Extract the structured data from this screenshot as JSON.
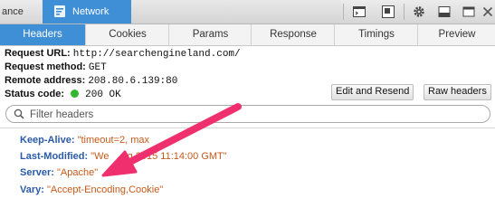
{
  "toolbar": {
    "prev_tab_label": "ance",
    "active_tab_label": "Network"
  },
  "subtabs": [
    "Headers",
    "Cookies",
    "Params",
    "Response",
    "Timings",
    "Preview"
  ],
  "request": {
    "url_label": "Request URL:",
    "url_value": "http://searchengineland.com/",
    "method_label": "Request method:",
    "method_value": "GET",
    "remote_label": "Remote address:",
    "remote_value": "208.80.6.139:80",
    "status_label": "Status code:",
    "status_value": "200 OK",
    "status_color": "#31b82f"
  },
  "buttons": {
    "edit_resend": "Edit and Resend",
    "raw_headers": "Raw headers"
  },
  "filter": {
    "placeholder": "Filter headers"
  },
  "headers": [
    {
      "key": "Keep-Alive:",
      "value": "\"timeout=2, max"
    },
    {
      "key": "Last-Modified:",
      "value": "\"We",
      "value_tail": "ug 2015 11:14:00 GMT\""
    },
    {
      "key": "Server:",
      "value": "\"Apache\""
    },
    {
      "key": "Vary:",
      "value": "\"Accept-Encoding,Cookie\""
    }
  ],
  "colors": {
    "accent": "#3f8fd6",
    "header_key": "#2a5aa8",
    "header_value": "#c55a1a",
    "annotation_arrow": "#f0306e"
  }
}
